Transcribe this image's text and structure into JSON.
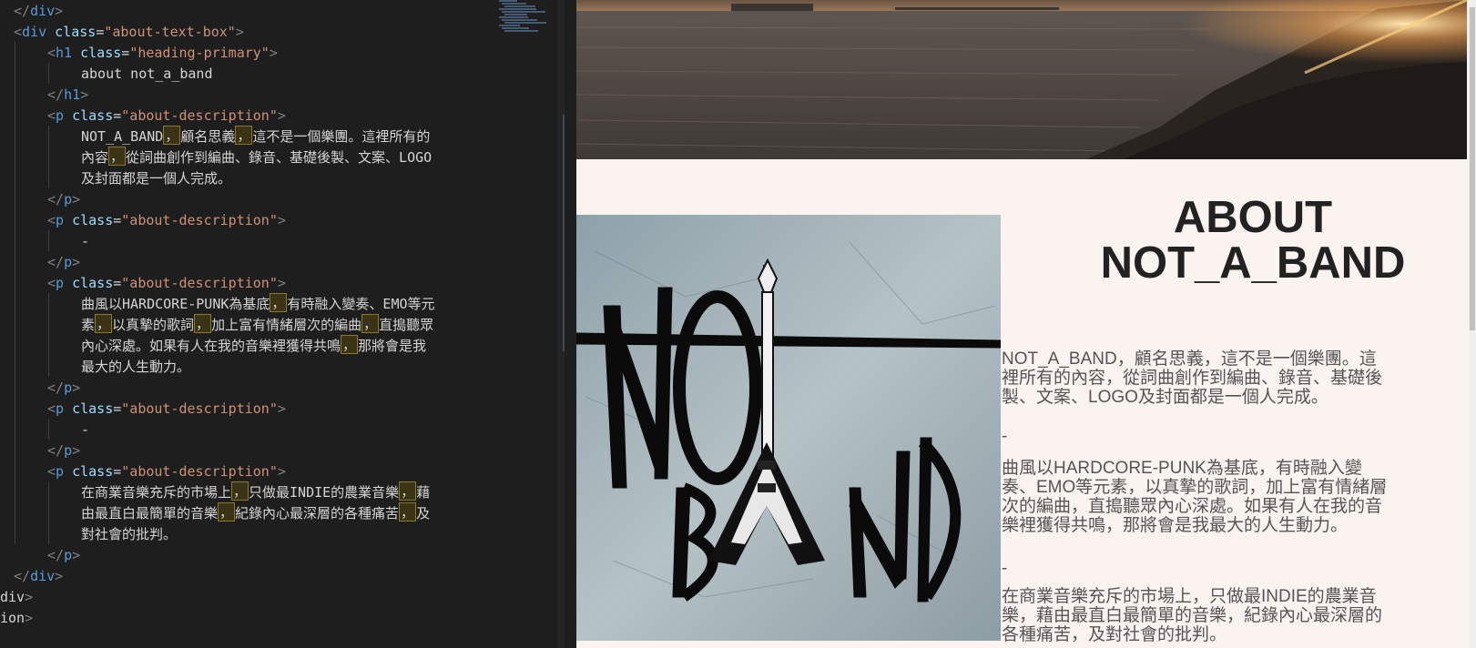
{
  "editor": {
    "lines": [
      {
        "indent": 0,
        "segments": [
          [
            "tag",
            "</"
          ],
          [
            "tn",
            "div"
          ],
          [
            "tag",
            ">"
          ]
        ]
      },
      {
        "indent": 0,
        "segments": [
          [
            "tag",
            "<"
          ],
          [
            "tn",
            "div "
          ],
          [
            "an",
            "class"
          ],
          [
            "tx",
            "="
          ],
          [
            "av",
            "\"about-text-box\""
          ],
          [
            "tag",
            ">"
          ]
        ]
      },
      {
        "indent": 1,
        "segments": [
          [
            "tag",
            "<"
          ],
          [
            "tn",
            "h1 "
          ],
          [
            "an",
            "class"
          ],
          [
            "tx",
            "="
          ],
          [
            "av",
            "\"heading-primary\""
          ],
          [
            "tag",
            ">"
          ]
        ]
      },
      {
        "indent": 2,
        "segments": [
          [
            "tx",
            "about not_a_band"
          ]
        ]
      },
      {
        "indent": 1,
        "segments": [
          [
            "tag",
            "</"
          ],
          [
            "tn",
            "h1"
          ],
          [
            "tag",
            ">"
          ]
        ]
      },
      {
        "indent": 1,
        "segments": [
          [
            "tag",
            "<"
          ],
          [
            "tn",
            "p "
          ],
          [
            "an",
            "class"
          ],
          [
            "tx",
            "="
          ],
          [
            "av",
            "\"about-description\""
          ],
          [
            "tag",
            ">"
          ]
        ]
      },
      {
        "indent": 2,
        "segments": [
          [
            "tx",
            "NOT_A_BAND"
          ],
          [
            "cm",
            "，"
          ],
          [
            "tx",
            "顧名思義"
          ],
          [
            "cm",
            "，"
          ],
          [
            "tx",
            "這不是一個樂團。這裡所有的"
          ]
        ]
      },
      {
        "indent": 2,
        "segments": [
          [
            "tx",
            "內容"
          ],
          [
            "cm",
            "，"
          ],
          [
            "tx",
            "從詞曲創作到編曲、錄音、基礎後製、文案、LOGO"
          ]
        ]
      },
      {
        "indent": 2,
        "segments": [
          [
            "tx",
            "及封面都是一個人完成。"
          ]
        ]
      },
      {
        "indent": 1,
        "segments": [
          [
            "tag",
            "</"
          ],
          [
            "tn",
            "p"
          ],
          [
            "tag",
            ">"
          ]
        ]
      },
      {
        "indent": 1,
        "segments": [
          [
            "tag",
            "<"
          ],
          [
            "tn",
            "p "
          ],
          [
            "an",
            "class"
          ],
          [
            "tx",
            "="
          ],
          [
            "av",
            "\"about-description\""
          ],
          [
            "tag",
            ">"
          ]
        ]
      },
      {
        "indent": 2,
        "segments": [
          [
            "tx",
            "-"
          ]
        ]
      },
      {
        "indent": 1,
        "segments": [
          [
            "tag",
            "</"
          ],
          [
            "tn",
            "p"
          ],
          [
            "tag",
            ">"
          ]
        ]
      },
      {
        "indent": 1,
        "segments": [
          [
            "tag",
            "<"
          ],
          [
            "tn",
            "p "
          ],
          [
            "an",
            "class"
          ],
          [
            "tx",
            "="
          ],
          [
            "av",
            "\"about-description\""
          ],
          [
            "tag",
            ">"
          ]
        ]
      },
      {
        "indent": 2,
        "segments": [
          [
            "tx",
            "曲風以HARDCORE-PUNK為基底"
          ],
          [
            "cm",
            "，"
          ],
          [
            "tx",
            "有時融入變奏、EMO等元"
          ]
        ]
      },
      {
        "indent": 2,
        "segments": [
          [
            "tx",
            "素"
          ],
          [
            "cm",
            "，"
          ],
          [
            "tx",
            "以真摯的歌詞"
          ],
          [
            "cm",
            "，"
          ],
          [
            "tx",
            "加上富有情緒層次的編曲"
          ],
          [
            "cm",
            "，"
          ],
          [
            "tx",
            "直搗聽眾"
          ]
        ]
      },
      {
        "indent": 2,
        "segments": [
          [
            "tx",
            "內心深處。如果有人在我的音樂裡獲得共鳴"
          ],
          [
            "cm",
            "，"
          ],
          [
            "tx",
            "那將會是我"
          ]
        ]
      },
      {
        "indent": 2,
        "segments": [
          [
            "tx",
            "最大的人生動力。"
          ]
        ]
      },
      {
        "indent": 1,
        "segments": [
          [
            "tag",
            "</"
          ],
          [
            "tn",
            "p"
          ],
          [
            "tag",
            ">"
          ]
        ]
      },
      {
        "indent": 1,
        "segments": [
          [
            "tag",
            "<"
          ],
          [
            "tn",
            "p "
          ],
          [
            "an",
            "class"
          ],
          [
            "tx",
            "="
          ],
          [
            "av",
            "\"about-description\""
          ],
          [
            "tag",
            ">"
          ]
        ]
      },
      {
        "indent": 2,
        "segments": [
          [
            "tx",
            "-"
          ]
        ]
      },
      {
        "indent": 1,
        "segments": [
          [
            "tag",
            "</"
          ],
          [
            "tn",
            "p"
          ],
          [
            "tag",
            ">"
          ]
        ]
      },
      {
        "indent": 1,
        "segments": [
          [
            "tag",
            "<"
          ],
          [
            "tn",
            "p "
          ],
          [
            "an",
            "class"
          ],
          [
            "tx",
            "="
          ],
          [
            "av",
            "\"about-description\""
          ],
          [
            "tag",
            ">"
          ]
        ]
      },
      {
        "indent": 2,
        "segments": [
          [
            "tx",
            "在商業音樂充斥的市場上"
          ],
          [
            "cm",
            "，"
          ],
          [
            "tx",
            "只做最INDIE的農業音樂"
          ],
          [
            "cm",
            "，"
          ],
          [
            "tx",
            "藉"
          ]
        ]
      },
      {
        "indent": 2,
        "segments": [
          [
            "tx",
            "由最直白最簡單的音樂"
          ],
          [
            "cm",
            "，"
          ],
          [
            "tx",
            "紀錄內心最深層的各種痛苦"
          ],
          [
            "cm",
            "，"
          ],
          [
            "tx",
            "及"
          ]
        ]
      },
      {
        "indent": 2,
        "segments": [
          [
            "tx",
            "對社會的批判。"
          ]
        ]
      },
      {
        "indent": 1,
        "segments": [
          [
            "tag",
            "</"
          ],
          [
            "tn",
            "p"
          ],
          [
            "tag",
            ">"
          ]
        ]
      },
      {
        "indent": 0,
        "segments": [
          [
            "tag",
            "</"
          ],
          [
            "tn",
            "div"
          ],
          [
            "tag",
            ">"
          ]
        ]
      },
      {
        "indent": -1,
        "segments": [
          [
            "tx",
            "div"
          ],
          [
            "tag",
            ">"
          ]
        ]
      },
      {
        "indent": -1,
        "segments": [
          [
            "tx",
            "ion"
          ],
          [
            "tag",
            ">"
          ]
        ]
      }
    ]
  },
  "preview": {
    "about": {
      "heading": "ABOUT\nNOT_A_BAND",
      "descriptions": [
        {
          "lines": [
            "NOT_A_BAND，顧名思義，這不是一個樂團。這",
            "裡所有的內容，從詞曲創作到編曲、錄音、基礎後",
            "製、文案、LOGO及封面都是一個人完成。"
          ]
        },
        {
          "lines": [
            "-"
          ]
        },
        {
          "lines": [
            "曲風以HARDCORE-PUNK為基底，有時融入變",
            "奏、EMO等元素，以真摯的歌詞，加上富有情緒層",
            "次的編曲，直搗聽眾內心深處。如果有人在我的音",
            "樂裡獲得共鳴，那將會是我最大的人生動力。"
          ]
        },
        {
          "lines": [
            "-"
          ]
        },
        {
          "lines": [
            "在商業音樂充斥的市場上，只做最INDIE的農業音",
            "樂，藉由最直白最簡單的音樂，紀錄內心最深層的",
            "各種痛苦，及對社會的批判。"
          ]
        }
      ],
      "logo_text": "NOT A BAND"
    }
  },
  "colors": {
    "editor_bg": "#1e1e1e",
    "tag": "#808080",
    "tag_name": "#569cd6",
    "attr_name": "#9cdcfe",
    "attr_value": "#ce9178",
    "text": "#d4d4d4",
    "page_bg": "#fbf3f0",
    "heading": "#222222",
    "description": "#555555"
  }
}
